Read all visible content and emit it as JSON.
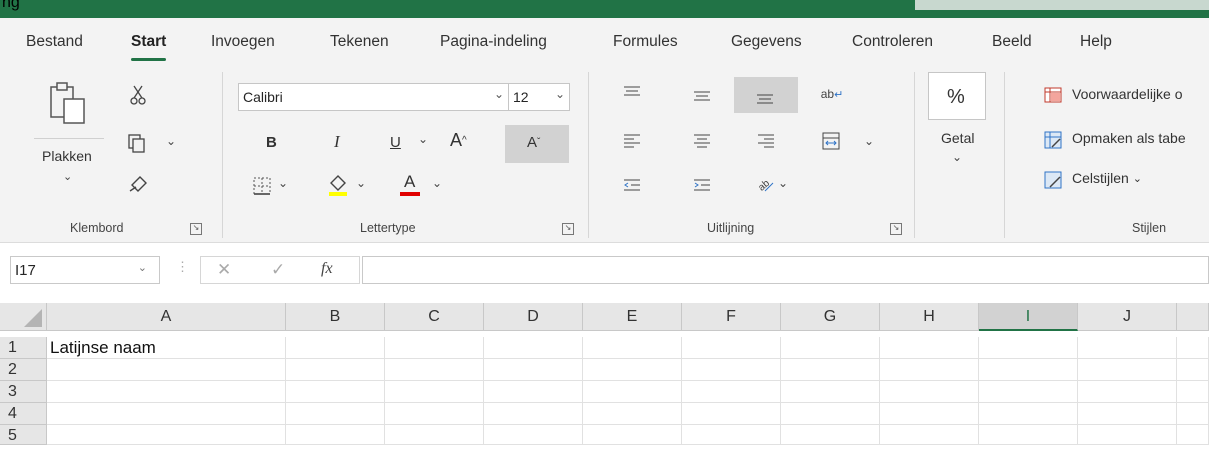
{
  "window": {
    "title_fragment": "ng"
  },
  "tabs": [
    {
      "label": "Bestand",
      "active": false
    },
    {
      "label": "Start",
      "active": true
    },
    {
      "label": "Invoegen",
      "active": false
    },
    {
      "label": "Tekenen",
      "active": false
    },
    {
      "label": "Pagina-indeling",
      "active": false
    },
    {
      "label": "Formules",
      "active": false
    },
    {
      "label": "Gegevens",
      "active": false
    },
    {
      "label": "Controleren",
      "active": false
    },
    {
      "label": "Beeld",
      "active": false
    },
    {
      "label": "Help",
      "active": false
    }
  ],
  "ribbon": {
    "clipboard": {
      "label": "Klembord",
      "paste_label": "Plakken"
    },
    "font": {
      "label": "Lettertype",
      "font_name": "Calibri",
      "font_size": "12",
      "bold": "B",
      "italic": "I",
      "underline": "U",
      "grow": "A",
      "shrink": "A",
      "font_color_letter": "A"
    },
    "alignment": {
      "label": "Uitlijning",
      "wrap_text": "ab"
    },
    "number": {
      "label": "Getal",
      "percent": "%"
    },
    "styles": {
      "label": "Stijlen",
      "conditional": "Voorwaardelijke o",
      "table": "Opmaken als tabe",
      "cell_styles": "Celstijlen"
    }
  },
  "formula_bar": {
    "name_box": "I17",
    "fx": "fx",
    "value": ""
  },
  "grid": {
    "columns": [
      "A",
      "B",
      "C",
      "D",
      "E",
      "F",
      "G",
      "H",
      "I",
      "J"
    ],
    "selected_column": "I",
    "rows": [
      "1",
      "2",
      "3",
      "4",
      "5"
    ],
    "cells": {
      "A1": "Latijnse naam"
    }
  },
  "colors": {
    "accent": "#217346",
    "highlight": "#ffff00",
    "font_red": "#e00000"
  }
}
